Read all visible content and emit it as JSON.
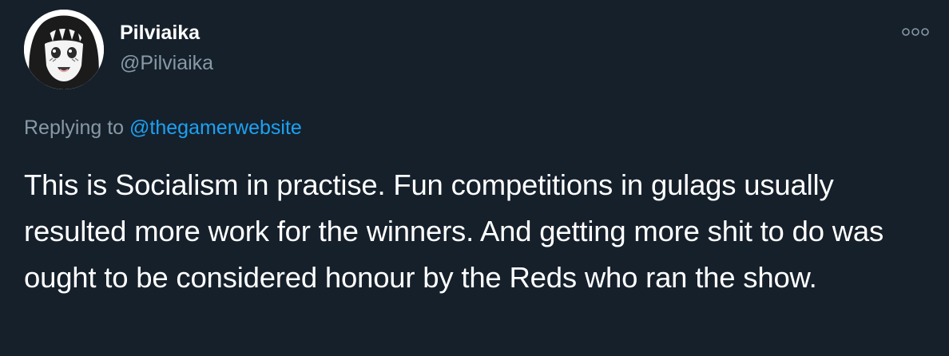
{
  "author": {
    "display_name": "Pilviaika",
    "handle": "@Pilviaika",
    "avatar_icon": "anime-girl-avatar"
  },
  "more_icon": "more-options-icon",
  "reply": {
    "prefix": "Replying to ",
    "mention": "@thegamerwebsite"
  },
  "tweet": {
    "text": "This is Socialism in practise. Fun competitions in gulags usually resulted more work for the winners. And getting more shit to do was ought to be considered honour by the Reds who ran the show."
  },
  "colors": {
    "background": "#15202b",
    "primary_text": "#ffffff",
    "secondary_text": "#8899a6",
    "link": "#1da1f2"
  }
}
